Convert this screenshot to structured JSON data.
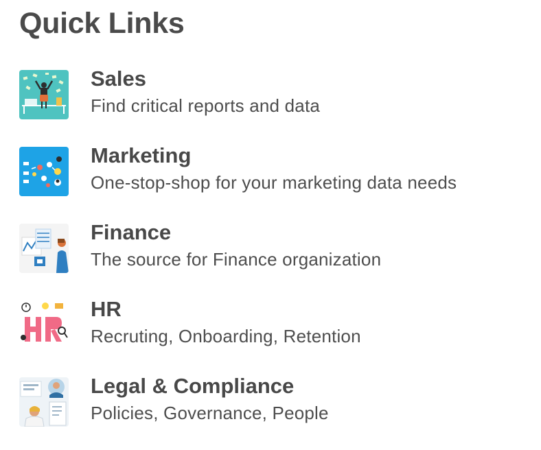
{
  "heading": "Quick Links",
  "links": [
    {
      "title": "Sales",
      "description": "Find critical reports and data",
      "icon": "sales-illustration-icon"
    },
    {
      "title": "Marketing",
      "description": "One-stop-shop for your marketing data needs",
      "icon": "marketing-illustration-icon"
    },
    {
      "title": "Finance",
      "description": "The source for Finance organization",
      "icon": "finance-illustration-icon"
    },
    {
      "title": "HR",
      "description": "Recruting, Onboarding, Retention",
      "icon": "hr-illustration-icon"
    },
    {
      "title": "Legal & Compliance",
      "description": "Policies, Governance, People",
      "icon": "legal-illustration-icon"
    }
  ],
  "colors": {
    "text": "#484848",
    "sales_bg": "#4fc3c0",
    "marketing_bg": "#1ea3e6",
    "hr_accent": "#f06a86"
  }
}
